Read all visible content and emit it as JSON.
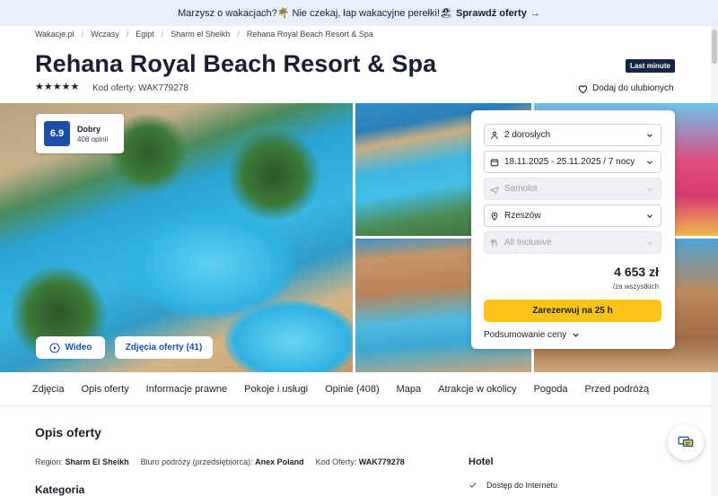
{
  "promo": {
    "text": "Marzysz o wakacjach?🌴 Nie czekaj, łap wakacyjne perełki!🏖",
    "cta": "Sprawdź oferty",
    "arrow": "→"
  },
  "breadcrumb": [
    "Wakacje.pl",
    "Wczasy",
    "Egipt",
    "Sharm el Sheikh",
    "Rehana Royal Beach Resort & Spa"
  ],
  "breadcrumb_sep": "/",
  "hotel": {
    "name": "Rehana Royal Beach Resort & Spa",
    "badge": "Last minute",
    "stars": "★★★★★",
    "offer_code": "Kod oferty: WAK779278",
    "favorite": "Dodaj do ulubionych"
  },
  "rating": {
    "score": "6.9",
    "label": "Dobry",
    "count": "408 opinii"
  },
  "gallery": {
    "video": "Wideo",
    "photos": "Zdjęcia oferty (41)"
  },
  "booking": {
    "guests": "2 dorosłych",
    "dates": "18.11.2025 - 25.11.2025 / 7 nocy",
    "transport": "Samolot",
    "departure": "Rzeszów",
    "board": "All Inclusive",
    "price": "4 653 zł",
    "price_note": "/za wszystkich",
    "book": "Zarezerwuj na 25 h",
    "summary": "Podsumowanie ceny"
  },
  "tabs": [
    "Zdjęcia",
    "Opis oferty",
    "Informacje prawne",
    "Pokoje i usługi",
    "Opinie (408)",
    "Mapa",
    "Atrakcje w okolicy",
    "Pogoda",
    "Przed podróżą"
  ],
  "description": {
    "title": "Opis oferty",
    "region_label": "Region:",
    "region": "Sharm El Sheikh",
    "operator_label": "Biuro podróży (przedsiębiorca):",
    "operator": "Anex Poland",
    "code_label": "Kod Oferty:",
    "code": "WAK779278",
    "category": "Kategoria"
  },
  "hotel_box": {
    "title": "Hotel",
    "item": "Dostęp do Internetu"
  },
  "colors": {
    "accent": "#1d4ea8",
    "book_button": "#fcc419",
    "badge": "#14254a",
    "promo_bg": "#e8f0fb"
  }
}
